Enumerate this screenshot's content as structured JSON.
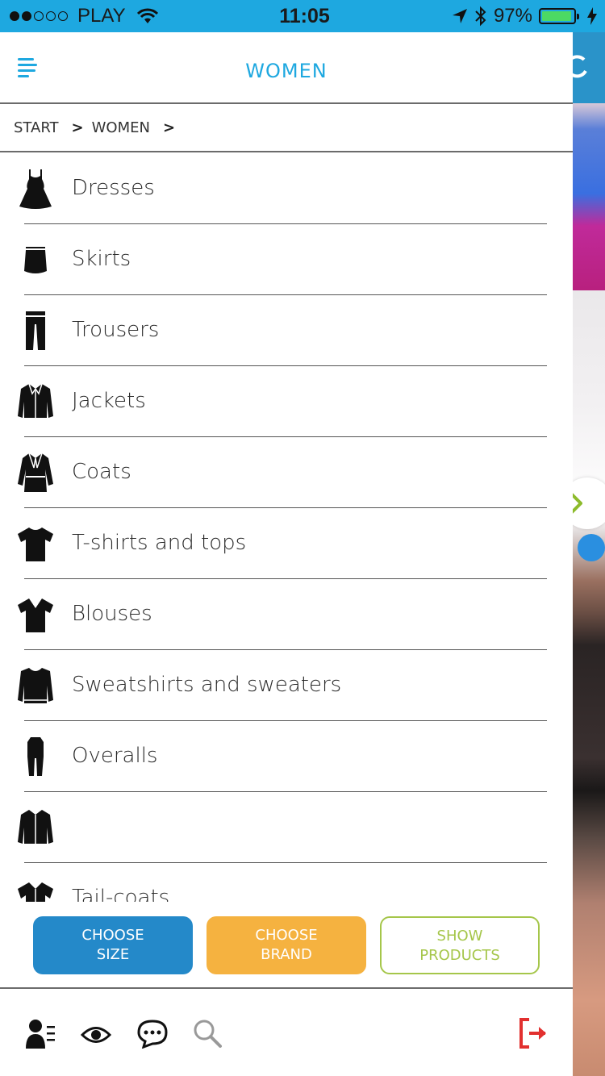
{
  "status_bar": {
    "carrier": "PLAY",
    "time": "11:05",
    "battery": "97%"
  },
  "header": {
    "title": "WOMEN"
  },
  "breadcrumb": {
    "start": "START",
    "women": "WOMEN",
    "separator": ">"
  },
  "categories": [
    {
      "label": "Dresses",
      "icon": "dress-icon"
    },
    {
      "label": "Skirts",
      "icon": "skirt-icon"
    },
    {
      "label": "Trousers",
      "icon": "trousers-icon"
    },
    {
      "label": "Jackets",
      "icon": "jacket-icon"
    },
    {
      "label": "Coats",
      "icon": "coat-icon"
    },
    {
      "label": "T-shirts and tops",
      "icon": "tshirt-icon"
    },
    {
      "label": "Blouses",
      "icon": "blouse-icon"
    },
    {
      "label": "Sweatshirts and sweaters",
      "icon": "sweater-icon"
    },
    {
      "label": "Overalls",
      "icon": "overalls-icon"
    },
    {
      "label": "",
      "icon": "jacket-icon"
    },
    {
      "label": "Tail-coats",
      "icon": "shirt-icon"
    }
  ],
  "actions": {
    "choose_size": [
      "CHOOSE",
      "SIZE"
    ],
    "choose_brand": [
      "CHOOSE",
      "BRAND"
    ],
    "show_products": [
      "SHOW",
      "PRODUCTS"
    ]
  },
  "colors": {
    "accent_blue": "#1ea8e0",
    "size_button": "#2489c9",
    "brand_button": "#f5b240",
    "show_button": "#a5c64a",
    "logout_red": "#e2302f"
  }
}
